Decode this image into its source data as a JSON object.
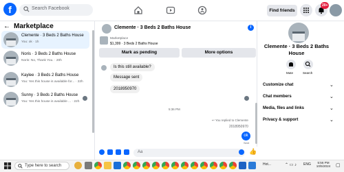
{
  "colors": {
    "accent": "#0866ff",
    "badge": "#e41e3f",
    "active_chat": "#e7f3ff"
  },
  "topbar": {
    "logo": "f",
    "search_placeholder": "Search Facebook",
    "find_friends": "Find friends",
    "notif_count": "20+"
  },
  "left": {
    "title": "Marketplace",
    "chats": [
      {
        "name": "Clemente · 3 Beds 2 Baths House",
        "snippet": "You: ok · 1h"
      },
      {
        "name": "Noris · 3 Beds 2 Baths House",
        "snippet": "Noris: No, Thank You. · 20h"
      },
      {
        "name": "Kaylee · 3 Beds 2 Baths House",
        "snippet": "You: Yes this house is available for... · 22h"
      },
      {
        "name": "Sunny · 3 Beds 2 Baths House",
        "snippet": "You: Yes this house is available ... · 22h"
      }
    ]
  },
  "conversation": {
    "title": "Clemente · 3 Beds 2 Baths House",
    "marketplace_label": "Marketplace",
    "listing": "$1,399 · 3 Beds 2 Baths House",
    "mark_pending": "Mark as pending",
    "more_options": "More options",
    "messages": [
      "Is this still available?",
      "Message sent",
      "2018950970"
    ],
    "timestamp": "5:36 PM",
    "replied_to": "You replied to Clemente",
    "quoted": "2018950970",
    "last_message": "ok",
    "status": "Sent",
    "composer_placeholder": "Aa"
  },
  "right": {
    "name": "Clemente · 3 Beds 2 Baths House",
    "mute": "Mute",
    "search": "Search",
    "sections": [
      "Customize chat",
      "Chat members",
      "Media, files and links",
      "Privacy & support"
    ]
  },
  "taskbar": {
    "search_placeholder": "Type here to search",
    "hot": "Hot...",
    "lang": "ENG",
    "time": "5:56 PM",
    "date": "10/5/2024"
  }
}
